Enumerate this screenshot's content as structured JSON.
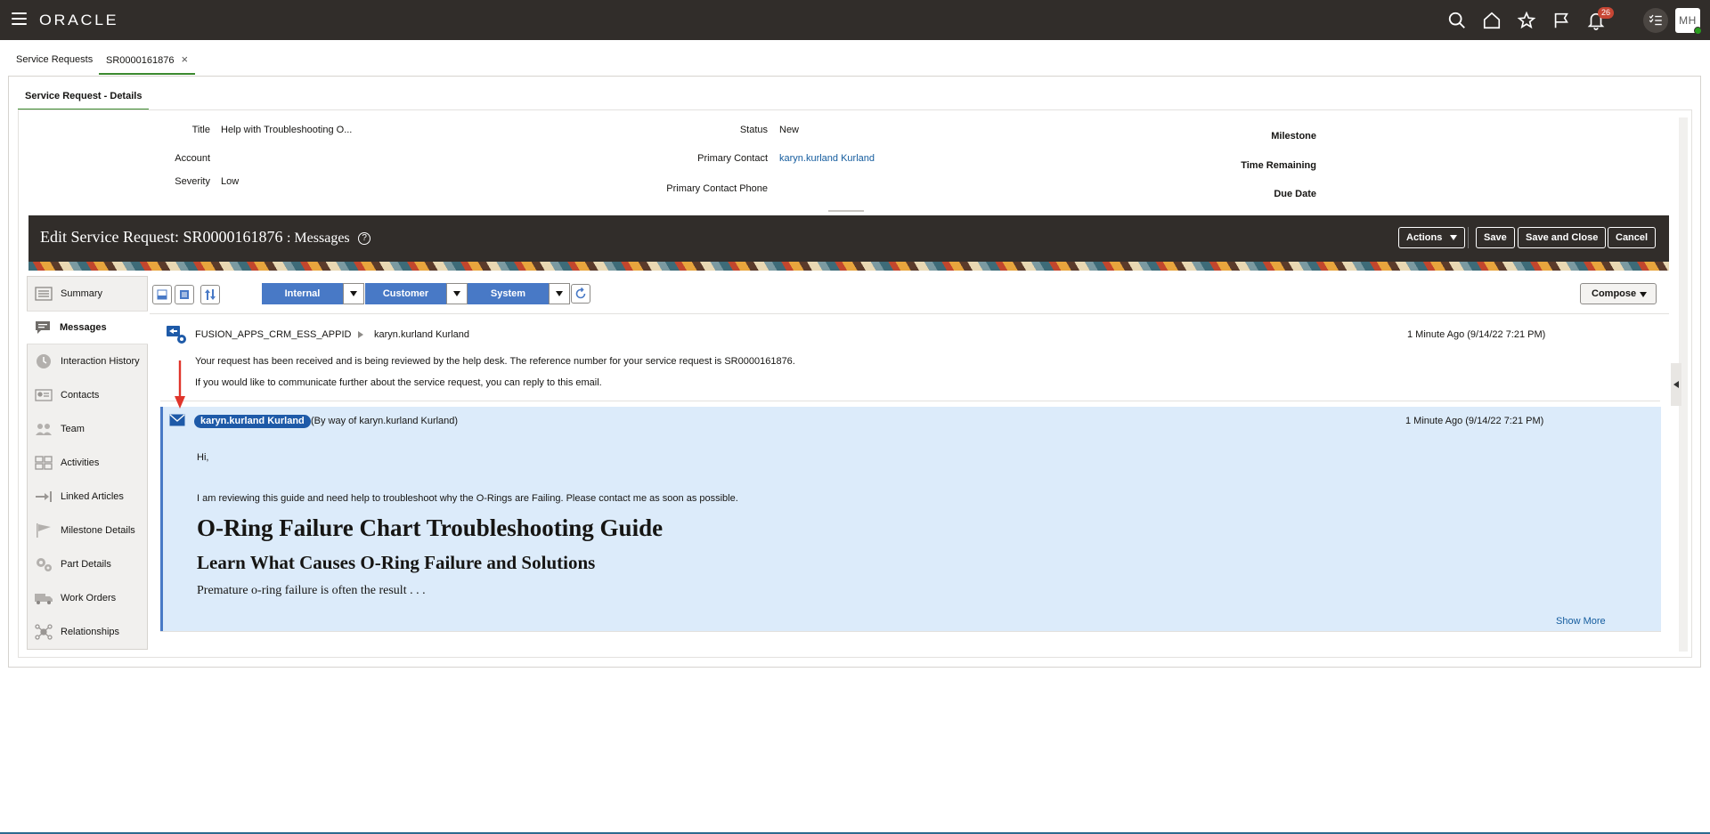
{
  "header": {
    "logo": "ORACLE",
    "notifications_count": "26",
    "user_initials": "MH"
  },
  "tabs": [
    {
      "label": "Service Requests"
    },
    {
      "label": "SR0000161876"
    }
  ],
  "subtab": "Service Request - Details",
  "details": {
    "title_label": "Title",
    "title_value": "Help with Troubleshooting O...",
    "account_label": "Account",
    "severity_label": "Severity",
    "severity_value": "Low",
    "status_label": "Status",
    "status_value": "New",
    "primary_contact_label": "Primary Contact",
    "primary_contact_value": "karyn.kurland Kurland",
    "primary_contact_phone_label": "Primary Contact Phone",
    "milestone_label": "Milestone",
    "time_remaining_label": "Time Remaining",
    "due_date_label": "Due Date"
  },
  "banner": {
    "title": "Edit Service Request: SR0000161876",
    "subtitle": ": Messages",
    "help": "?",
    "actions": "Actions",
    "save": "Save",
    "save_and_close": "Save and Close",
    "cancel": "Cancel"
  },
  "nav": [
    {
      "label": "Summary",
      "icon": "summary-icon"
    },
    {
      "label": "Messages",
      "icon": "messages-icon"
    },
    {
      "label": "Interaction History",
      "icon": "clock-icon"
    },
    {
      "label": "Contacts",
      "icon": "contacts-icon"
    },
    {
      "label": "Team",
      "icon": "team-icon"
    },
    {
      "label": "Activities",
      "icon": "activities-icon"
    },
    {
      "label": "Linked Articles",
      "icon": "linked-articles-icon"
    },
    {
      "label": "Milestone Details",
      "icon": "milestone-flag-icon"
    },
    {
      "label": "Part Details",
      "icon": "gear-parts-icon"
    },
    {
      "label": "Work Orders",
      "icon": "truck-icon"
    },
    {
      "label": "Relationships",
      "icon": "relationships-icon"
    }
  ],
  "toolbar": {
    "filters": [
      "Internal",
      "Customer",
      "System"
    ],
    "compose": "Compose"
  },
  "messages": [
    {
      "sender": "FUSION_APPS_CRM_ESS_APPID",
      "recipient": "karyn.kurland Kurland",
      "time": "1 Minute Ago (9/14/22 7:21 PM)",
      "body1": "Your request has been received and is being reviewed by the help desk. The reference number for your service request is SR0000161876.",
      "body2": "If you would like to communicate further about the service request, you can reply to this email."
    },
    {
      "sender": "karyn.kurland Kurland",
      "via": "(By way of karyn.kurland Kurland)",
      "time": "1 Minute Ago (9/14/22 7:21 PM)",
      "greeting": "Hi,",
      "body": "I am reviewing this guide and need help to troubleshoot why the O-Rings are Failing.  Please contact me as soon as possible.",
      "heading1": "O-Ring Failure Chart Troubleshooting Guide",
      "heading2": "Learn What Causes O-Ring Failure and Solutions",
      "paragraph": "Premature o-ring failure is often the result . . .",
      "show_more": "Show More"
    }
  ],
  "colors": {
    "header_bg": "#312d2a",
    "accent_green": "#3c8a2f",
    "filter_blue": "#4879c6",
    "link_blue": "#145c9e",
    "selected_message_bg": "#dcebfa",
    "annotation_arrow": "#e0352b"
  }
}
